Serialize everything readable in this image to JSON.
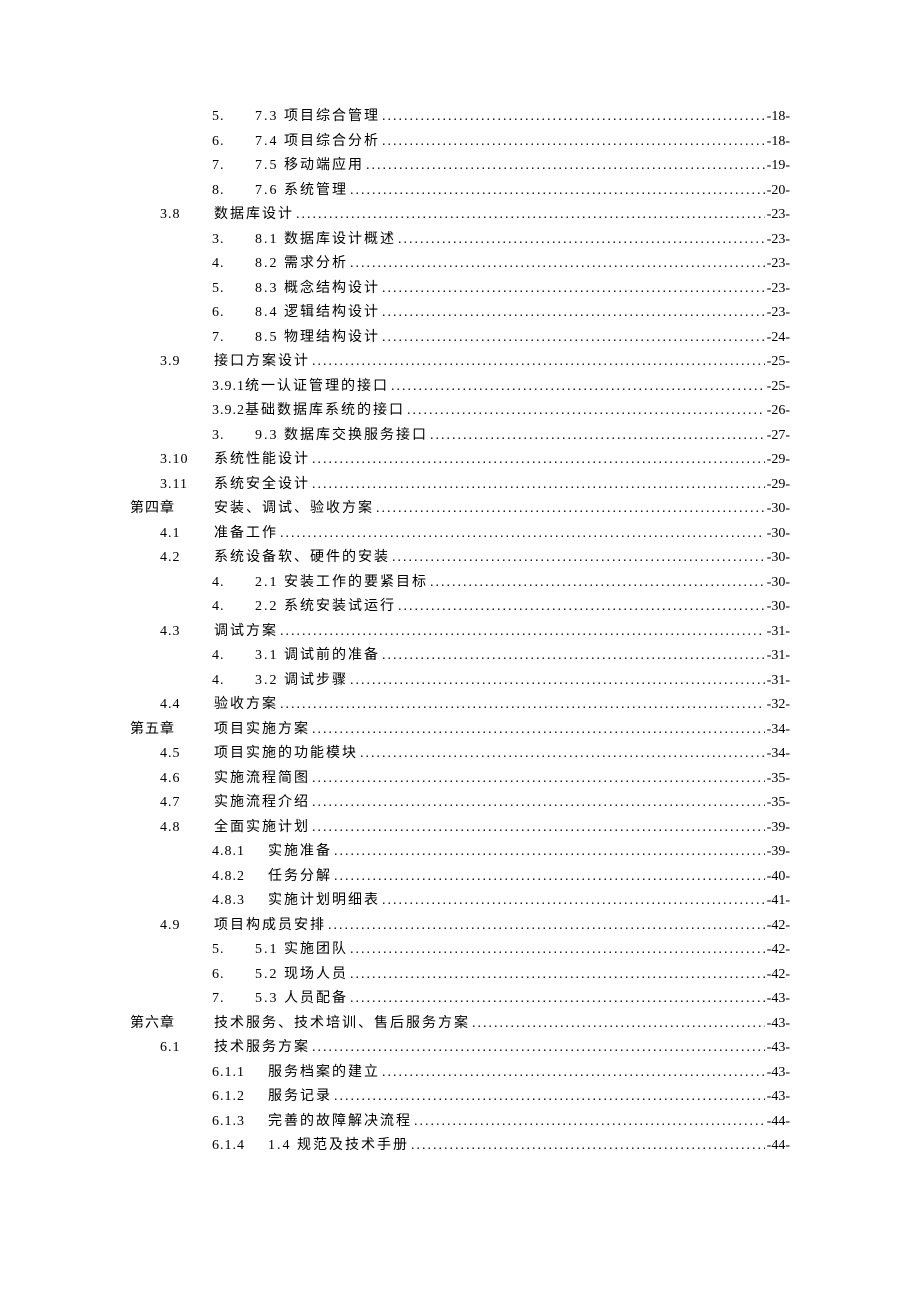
{
  "entries": [
    {
      "level": "lvl-2",
      "num": "5.",
      "title": "7.3 项目综合管理",
      "page": "-18-"
    },
    {
      "level": "lvl-2",
      "num": "6.",
      "title": "7.4 项目综合分析",
      "page": "-18-"
    },
    {
      "level": "lvl-2",
      "num": "7.",
      "title": "7.5 移动端应用",
      "page": "-19-"
    },
    {
      "level": "lvl-2",
      "num": "8.",
      "title": "7.6 系统管理",
      "page": "-20-"
    },
    {
      "level": "lvl-1",
      "num": "3.8",
      "title": "数据库设计 ",
      "page": "-23-"
    },
    {
      "level": "lvl-2",
      "num": "3.",
      "title": "8.1 数据库设计概述",
      "page": "-23-"
    },
    {
      "level": "lvl-2",
      "num": "4.",
      "title": "8.2 需求分析",
      "page": "-23-"
    },
    {
      "level": "lvl-2",
      "num": "5.",
      "title": "8.3 概念结构设计",
      "page": "-23-"
    },
    {
      "level": "lvl-2",
      "num": "6.",
      "title": "8.4 逻辑结构设计",
      "page": "-23-"
    },
    {
      "level": "lvl-2",
      "num": "7.",
      "title": "8.5 物理结构设计",
      "page": "-24-"
    },
    {
      "level": "lvl-1",
      "num": "3.9",
      "title": "接口方案设计 ",
      "page": "-25-"
    },
    {
      "level": "lvl-2b",
      "num": "3.9.1",
      "title": "统一认证管理的接口 ",
      "page": "-25-"
    },
    {
      "level": "lvl-2b",
      "num": "3.9.2",
      "title": "基础数据库系统的接口 ",
      "page": "-26-"
    },
    {
      "level": "lvl-2",
      "num": "3.",
      "title": "9.3 数据库交换服务接口",
      "page": "-27-"
    },
    {
      "level": "lvl-1",
      "num": "3.10",
      "title": "系统性能设计 ",
      "page": "-29-"
    },
    {
      "level": "lvl-1",
      "num": "3.11",
      "title": "系统安全设计 ",
      "page": "-29-"
    },
    {
      "level": "lvl-0",
      "num": "第四章",
      "title": "安装、调试、验收方案",
      "page": "-30-"
    },
    {
      "level": "lvl-1",
      "num": "4.1",
      "title": "准备工作",
      "page": "-30-"
    },
    {
      "level": "lvl-1",
      "num": "4.2",
      "title": "系统设备软、硬件的安装",
      "page": "-30-"
    },
    {
      "level": "lvl-2",
      "num": "4.",
      "title": "2.1 安装工作的要紧目标",
      "page": "-30-"
    },
    {
      "level": "lvl-2",
      "num": "4.",
      "title": "2.2 系统安装试运行",
      "page": "-30-"
    },
    {
      "level": "lvl-1",
      "num": "4.3",
      "title": "调试方案",
      "page": "-31-"
    },
    {
      "level": "lvl-2",
      "num": "4.",
      "title": "3.1 调试前的准备",
      "page": "-31-"
    },
    {
      "level": "lvl-2",
      "num": "4.",
      "title": "3.2 调试步骤",
      "page": "-31-"
    },
    {
      "level": "lvl-1",
      "num": "4.4",
      "title": "验收方案 ",
      "page": "-32-"
    },
    {
      "level": "lvl-0",
      "num": "第五章",
      "title": "项目实施方案",
      "page": "-34-"
    },
    {
      "level": "lvl-1",
      "num": "4.5",
      "title": "项目实施的功能模块 ",
      "page": "-34-"
    },
    {
      "level": "lvl-1",
      "num": "4.6",
      "title": "实施流程简图 ",
      "page": "-35-"
    },
    {
      "level": "lvl-1",
      "num": "4.7",
      "title": "实施流程介绍 ",
      "page": "-35-"
    },
    {
      "level": "lvl-1",
      "num": "4.8",
      "title": "全面实施计划 ",
      "page": "-39-"
    },
    {
      "level": "lvl-2c",
      "num": "4.8.1",
      "title": "实施准备 ",
      "page": "-39-"
    },
    {
      "level": "lvl-2c",
      "num": "4.8.2",
      "title": "任务分解 ",
      "page": "-40-"
    },
    {
      "level": "lvl-2c",
      "num": "4.8.3",
      "title": "实施计划明细表",
      "page": "-41-"
    },
    {
      "level": "lvl-1",
      "num": "4.9",
      "title": "项目构成员安排 ",
      "page": "-42-"
    },
    {
      "level": "lvl-2",
      "num": "5.",
      "title": "5.1 实施团队",
      "page": "-42-"
    },
    {
      "level": "lvl-2",
      "num": "6.",
      "title": "5.2 现场人员",
      "page": "-42-"
    },
    {
      "level": "lvl-2",
      "num": "7.",
      "title": "5.3 人员配备",
      "page": "-43-"
    },
    {
      "level": "lvl-0",
      "num": "第六章",
      "title": "技术服务、技术培训、售后服务方案",
      "page": "-43-"
    },
    {
      "level": "lvl-1",
      "num": "6.1",
      "title": "技术服务方案 ",
      "page": "-43-"
    },
    {
      "level": "lvl-2c",
      "num": "6.1.1",
      "title": "服务档案的建立",
      "page": "-43-"
    },
    {
      "level": "lvl-2c",
      "num": "6.1.2",
      "title": "服务记录 ",
      "page": "-43-"
    },
    {
      "level": "lvl-2c",
      "num": "6.1.3",
      "title": "完善的故障解决流程",
      "page": "-44-"
    },
    {
      "level": "lvl-2c",
      "num": "6.1.4",
      "title": "1.4 规范及技术手册 ",
      "page": "-44-"
    }
  ]
}
